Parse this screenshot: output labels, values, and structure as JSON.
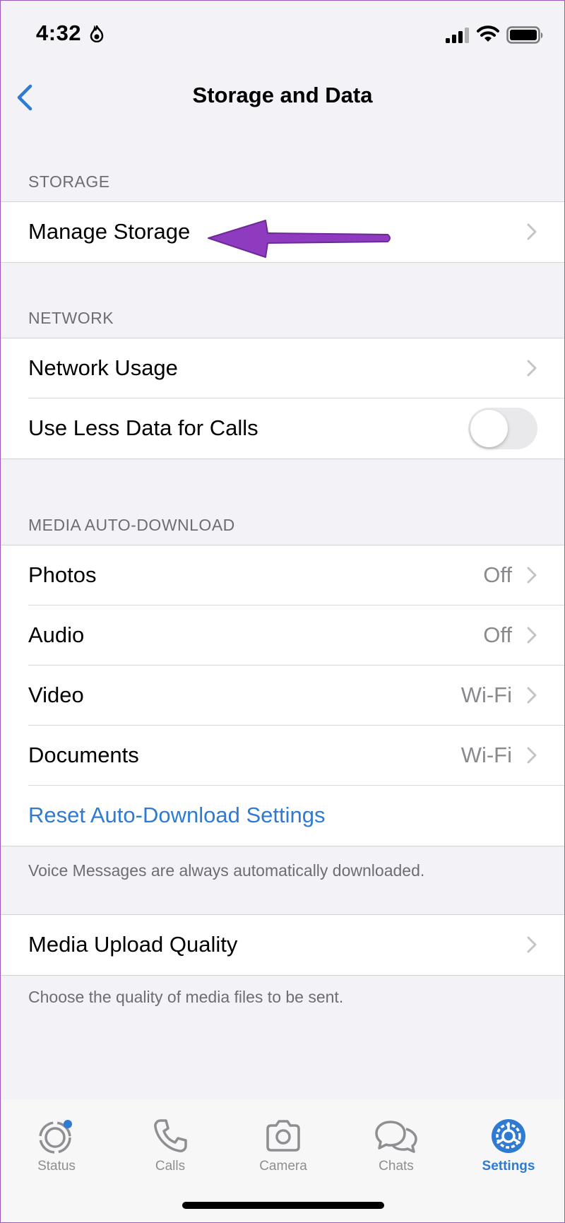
{
  "status_bar": {
    "time": "4:32"
  },
  "nav": {
    "title": "Storage and Data",
    "back_icon": "chevron-left-icon"
  },
  "sections": {
    "storage": {
      "header": "STORAGE",
      "items": [
        {
          "label": "Manage Storage"
        }
      ]
    },
    "network": {
      "header": "NETWORK",
      "items": [
        {
          "label": "Network Usage"
        },
        {
          "label": "Use Less Data for Calls",
          "toggle_on": false
        }
      ]
    },
    "media_auto_download": {
      "header": "MEDIA AUTO-DOWNLOAD",
      "items": [
        {
          "label": "Photos",
          "value": "Off"
        },
        {
          "label": "Audio",
          "value": "Off"
        },
        {
          "label": "Video",
          "value": "Wi-Fi"
        },
        {
          "label": "Documents",
          "value": "Wi-Fi"
        }
      ],
      "reset_label": "Reset Auto-Download Settings",
      "footer": "Voice Messages are always automatically downloaded."
    },
    "upload": {
      "items": [
        {
          "label": "Media Upload Quality"
        }
      ],
      "footer": "Choose the quality of media files to be sent."
    }
  },
  "tab_bar": {
    "tabs": [
      {
        "label": "Status",
        "icon": "status-icon"
      },
      {
        "label": "Calls",
        "icon": "phone-icon"
      },
      {
        "label": "Camera",
        "icon": "camera-icon"
      },
      {
        "label": "Chats",
        "icon": "chats-icon"
      },
      {
        "label": "Settings",
        "icon": "gear-icon",
        "active": true
      }
    ]
  },
  "colors": {
    "accent": "#2f7bd2",
    "annotation_arrow": "#8e3bbf",
    "background": "#f2f2f7"
  }
}
